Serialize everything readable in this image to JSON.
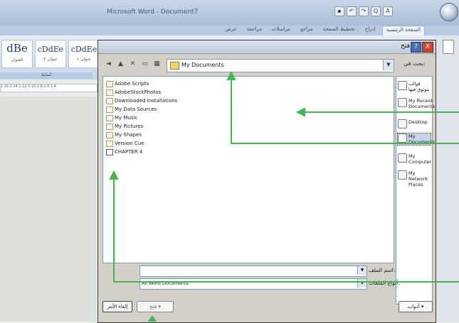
{
  "word": {
    "title": "Microsoft Word - Document7",
    "tabs": [
      "الصفحة الرئيسية",
      "إدراج",
      "تخطيط الصفحة",
      "مراجع",
      "مراسلات",
      "مراجعة",
      "عرض"
    ],
    "styles": [
      {
        "sample": "cDdEe",
        "name": "عنوان ١"
      },
      {
        "sample": "cDdEe",
        "name": "عنوان ٢"
      },
      {
        "sample": "dBe",
        "name": "العنوان"
      }
    ],
    "group_label": "أنماط",
    "ruler_text": "1·16·1·14·1·12·1·10·1·8·1·6·1·4"
  },
  "dialog": {
    "title": "فتح",
    "help": "?",
    "close": "X",
    "look_in_label": "بحث في:",
    "look_in_value": "My Documents",
    "files": [
      {
        "name": "Adobe Scripts",
        "type": "folder"
      },
      {
        "name": "AdobeStockPhotos",
        "type": "folder"
      },
      {
        "name": "Downloaded Installations",
        "type": "folder"
      },
      {
        "name": "My Data Sources",
        "type": "folder"
      },
      {
        "name": "My Music",
        "type": "folder"
      },
      {
        "name": "My Pictures",
        "type": "folder"
      },
      {
        "name": "My Shapes",
        "type": "folder"
      },
      {
        "name": "Version Cue",
        "type": "folder"
      },
      {
        "name": "CHAPTER 4",
        "type": "doc"
      }
    ],
    "places": [
      {
        "label": "قوالب موثوق فيها"
      },
      {
        "label": "My Recent Documents"
      },
      {
        "label": "Desktop"
      },
      {
        "label": "My Documents"
      },
      {
        "label": "My Computer"
      },
      {
        "label": "My Network Places"
      }
    ],
    "file_name_label": "اسم الملف:",
    "file_name_value": "",
    "file_type_label": "أنواع الملفات:",
    "file_type_value": "All Word Documents",
    "tools_button": "أدوات",
    "open_button": "فتح",
    "cancel_button": "إلغاء الأمر"
  },
  "annotation_color": "#43b64f"
}
